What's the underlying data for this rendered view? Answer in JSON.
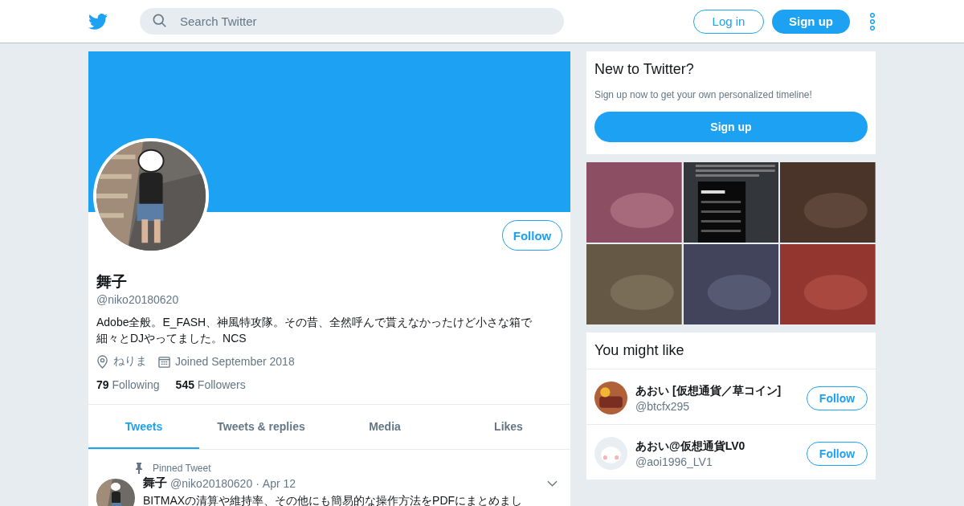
{
  "header": {
    "search": {
      "placeholder": "Search Twitter"
    },
    "login": "Log in",
    "signup": "Sign up"
  },
  "profile": {
    "follow": "Follow",
    "name": "舞子",
    "handle": "@niko20180620",
    "bio": "Adobe全般。E_FASH、神風特攻隊。その昔、全然呼んで貰えなかったけど小さな箱で細々とDJやってました。NCS",
    "location": "ねりま",
    "joined": "Joined September 2018",
    "stats": [
      {
        "count": "79",
        "label": "Following"
      },
      {
        "count": "545",
        "label": "Followers"
      }
    ]
  },
  "tabs": [
    {
      "label": "Tweets",
      "selected": true
    },
    {
      "label": "Tweets & replies",
      "selected": false
    },
    {
      "label": "Media",
      "selected": false
    },
    {
      "label": "Likes",
      "selected": false
    }
  ],
  "pinned_tweet": {
    "label": "Pinned Tweet",
    "name": "舞子",
    "handle": "@niko20180620",
    "separator": "·",
    "date": "Apr 12",
    "text": "BITMAXの清算や維持率、その他にも簡易的な操作方法をPDFにまとめまし"
  },
  "signup_card": {
    "title": "New to Twitter?",
    "text": "Sign up now to get your own personalized timeline!",
    "button": "Sign up"
  },
  "suggestions": {
    "title": "You might like",
    "items": [
      {
        "name": "あおい [仮想通貨／草コイン]",
        "handle": "@btcfx295",
        "follow": "Follow"
      },
      {
        "name": "あおい@仮想通貨LV0",
        "handle": "@aoi1996_LV1",
        "follow": "Follow"
      }
    ]
  }
}
